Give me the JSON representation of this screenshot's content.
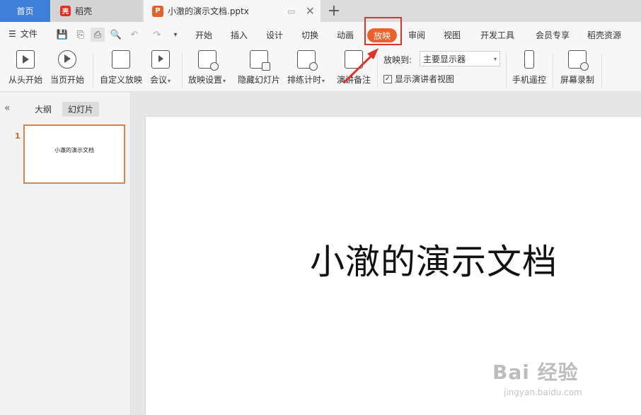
{
  "tabs": {
    "home": "首页",
    "daoke": "稻壳",
    "document": "小澈的演示文档.pptx",
    "add": "+"
  },
  "menu": {
    "file": "文件",
    "items": [
      "开始",
      "插入",
      "设计",
      "切换",
      "动画",
      "放映",
      "审阅",
      "视图",
      "开发工具",
      "会员专享",
      "稻壳资源"
    ],
    "active": "放映"
  },
  "ribbon": {
    "from_start": "从头开始",
    "from_current": "当页开始",
    "custom_show": "自定义放映",
    "meeting": "会议",
    "show_settings": "放映设置",
    "hide_slide": "隐藏幻灯片",
    "rehearse": "排练计时",
    "speaker_notes": "演讲备注",
    "project_to_label": "放映到:",
    "project_to_value": "主要显示器",
    "presenter_view": "显示演讲者视图",
    "phone_remote": "手机遥控",
    "screen_record": "屏幕录制"
  },
  "panel": {
    "outline_tab": "大纲",
    "slides_tab": "幻灯片",
    "slide_number": "1",
    "thumb_title": "小澈的演示文档"
  },
  "slide": {
    "title": "小澈的演示文档"
  },
  "watermark": {
    "main": "Bai 经验",
    "sub": "jingyan.baidu.com"
  },
  "colors": {
    "accent": "#e9622c",
    "home_tab": "#3f7fd8",
    "highlight_box": "#e0322a"
  }
}
